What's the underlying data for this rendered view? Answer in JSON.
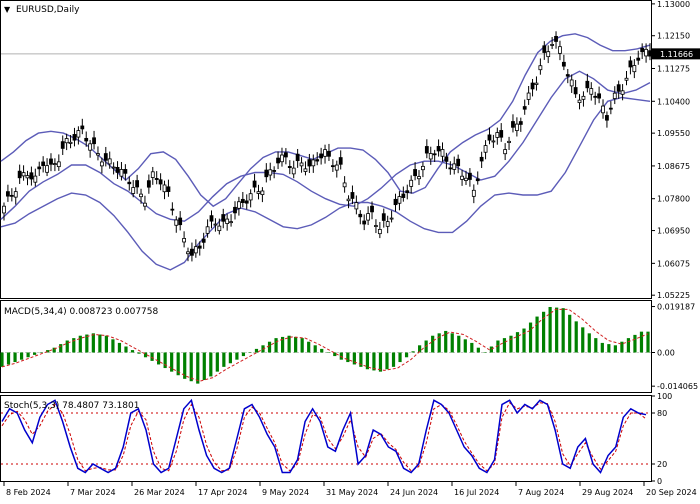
{
  "window": {
    "symbol_title": "EURUSD,Daily",
    "current_price_label": "1.11666"
  },
  "colors": {
    "bollinger": "#5c5cb8",
    "candles": "#000000",
    "macd_histogram": "#008000",
    "macd_signal": "#d02020",
    "stoch_main": "#0000cc",
    "stoch_signal": "#cc0000",
    "levels": "#cc0000",
    "grid": "#c8c8c8",
    "current_price_line": "#b0b0b0"
  },
  "chart_data": [
    {
      "type": "candlestick",
      "name": "price",
      "title": "EURUSD,Daily",
      "y_ticks": [
        "1.13000",
        "1.12150",
        "1.11275",
        "1.10400",
        "1.09550",
        "1.08675",
        "1.07800",
        "1.06950",
        "1.06075",
        "1.05225"
      ],
      "ylim": [
        1.0515,
        1.1305
      ],
      "current_price": 1.11666,
      "x_ticks": [
        "8 Feb 2024",
        "7 Mar 2024",
        "26 Mar 2024",
        "17 Apr 2024",
        "9 May 2024",
        "31 May 2024",
        "24 Jun 2024",
        "16 Jul 2024",
        "7 Aug 2024",
        "29 Aug 2024",
        "20 Sep 2024"
      ],
      "close_path": [
        1.076,
        1.079,
        1.083,
        1.085,
        1.083,
        1.088,
        1.086,
        1.089,
        1.093,
        1.0945,
        1.096,
        1.093,
        1.09,
        1.088,
        1.087,
        1.085,
        1.083,
        1.08,
        1.078,
        1.084,
        1.083,
        1.079,
        1.073,
        1.067,
        1.063,
        1.065,
        1.07,
        1.072,
        1.071,
        1.073,
        1.076,
        1.078,
        1.08,
        1.081,
        1.085,
        1.088,
        1.089,
        1.086,
        1.088,
        1.086,
        1.089,
        1.09,
        1.088,
        1.086,
        1.079,
        1.076,
        1.072,
        1.074,
        1.07,
        1.072,
        1.076,
        1.079,
        1.082,
        1.085,
        1.089,
        1.091,
        1.09,
        1.087,
        1.086,
        1.084,
        1.08,
        1.088,
        1.094,
        1.095,
        1.092,
        1.096,
        1.099,
        1.105,
        1.11,
        1.116,
        1.12,
        1.118,
        1.111,
        1.106,
        1.105,
        1.108,
        1.104,
        1.1,
        1.105,
        1.108,
        1.112,
        1.116,
        1.117
      ],
      "bollinger_upper": [
        1.088,
        1.0905,
        1.0935,
        1.0955,
        1.096,
        1.0955,
        1.094,
        1.092,
        1.089,
        1.086,
        1.083,
        1.086,
        1.09,
        1.0905,
        1.0885,
        1.084,
        1.079,
        1.076,
        1.078,
        1.082,
        1.086,
        1.089,
        1.0905,
        1.0905,
        1.0895,
        1.0885,
        1.09,
        1.0915,
        1.0915,
        1.091,
        1.0885,
        1.085,
        1.08,
        1.0795,
        1.081,
        1.086,
        1.0905,
        1.093,
        1.095,
        1.0965,
        1.099,
        1.104,
        1.111,
        1.117,
        1.12,
        1.1215,
        1.122,
        1.121,
        1.119,
        1.1175,
        1.1175,
        1.118,
        1.119
      ],
      "bollinger_middle": [
        1.0725,
        1.076,
        1.08,
        1.0825,
        1.0845,
        1.087,
        1.087,
        1.085,
        1.082,
        1.08,
        1.077,
        1.074,
        1.0725,
        1.072,
        1.0745,
        1.0785,
        1.082,
        1.084,
        1.085,
        1.085,
        1.0845,
        1.0825,
        1.08,
        1.078,
        1.0765,
        1.076,
        1.078,
        1.081,
        1.0845,
        1.087,
        1.088,
        1.088,
        1.087,
        1.085,
        1.083,
        1.084,
        1.088,
        1.093,
        1.099,
        1.105,
        1.11,
        1.112,
        1.11,
        1.107,
        1.106,
        1.107,
        1.109
      ],
      "bollinger_lower": [
        1.0705,
        1.0715,
        1.074,
        1.076,
        1.078,
        1.0795,
        1.079,
        1.077,
        1.0735,
        1.069,
        1.064,
        1.0605,
        1.059,
        1.061,
        1.066,
        1.07,
        1.074,
        1.0755,
        1.0745,
        1.0725,
        1.0705,
        1.07,
        1.071,
        1.073,
        1.0755,
        1.077,
        1.077,
        1.076,
        1.0745,
        1.072,
        1.07,
        1.069,
        1.069,
        1.072,
        1.076,
        1.079,
        1.0795,
        1.079,
        1.079,
        1.08,
        1.085,
        1.092,
        1.099,
        1.104,
        1.105,
        1.1045,
        1.104
      ]
    },
    {
      "type": "bar",
      "name": "macd",
      "title": "MACD(5,34,4) 0.008723 0.007758",
      "y_ticks": [
        "0.019187",
        "0.00",
        "-0.014065"
      ],
      "ylim": [
        -0.0165,
        0.0215
      ],
      "histogram": [
        -0.006,
        -0.004,
        -0.002,
        0.0,
        0.002,
        0.005,
        0.007,
        0.008,
        0.007,
        0.004,
        0.001,
        -0.002,
        -0.005,
        -0.008,
        -0.011,
        -0.013,
        -0.01,
        -0.006,
        -0.003,
        0.0,
        0.003,
        0.006,
        0.007,
        0.006,
        0.003,
        0.0,
        -0.003,
        -0.005,
        -0.007,
        -0.008,
        -0.006,
        -0.002,
        0.003,
        0.007,
        0.009,
        0.007,
        0.004,
        0.0,
        0.005,
        0.007,
        0.01,
        0.015,
        0.019,
        0.0185,
        0.013,
        0.008,
        0.004,
        0.003,
        0.006,
        0.0087
      ],
      "signal": [
        -0.006,
        -0.0045,
        -0.0025,
        -0.0005,
        0.0015,
        0.004,
        0.006,
        0.0075,
        0.007,
        0.005,
        0.002,
        -0.001,
        -0.004,
        -0.007,
        -0.01,
        -0.012,
        -0.0105,
        -0.007,
        -0.004,
        -0.001,
        0.002,
        0.005,
        0.0065,
        0.006,
        0.0035,
        0.0005,
        -0.0025,
        -0.0045,
        -0.0065,
        -0.0075,
        -0.0065,
        -0.003,
        0.002,
        0.006,
        0.0085,
        0.0075,
        0.0045,
        0.001,
        0.004,
        0.0065,
        0.009,
        0.014,
        0.018,
        0.018,
        0.014,
        0.009,
        0.005,
        0.0035,
        0.0055,
        0.0078
      ]
    },
    {
      "type": "line",
      "name": "stochastic",
      "title": "Stoch(5,3,3) 78.4807 73.1801",
      "y_ticks": [
        "100",
        "80",
        "20",
        "0"
      ],
      "ylim": [
        0,
        100
      ],
      "levels": [
        80,
        20
      ],
      "main": [
        70,
        85,
        80,
        60,
        45,
        75,
        90,
        95,
        70,
        40,
        15,
        10,
        20,
        15,
        10,
        15,
        40,
        80,
        85,
        60,
        20,
        10,
        15,
        50,
        85,
        95,
        60,
        30,
        15,
        10,
        15,
        50,
        85,
        90,
        75,
        55,
        40,
        10,
        10,
        25,
        70,
        85,
        70,
        40,
        35,
        60,
        80,
        20,
        30,
        60,
        55,
        40,
        35,
        15,
        10,
        20,
        60,
        95,
        90,
        80,
        60,
        40,
        30,
        15,
        10,
        25,
        90,
        95,
        80,
        90,
        85,
        95,
        90,
        60,
        20,
        15,
        40,
        50,
        20,
        10,
        30,
        40,
        75,
        85,
        80,
        78
      ],
      "signal": [
        65,
        78,
        82,
        72,
        55,
        65,
        82,
        90,
        80,
        55,
        25,
        12,
        15,
        16,
        13,
        13,
        30,
        65,
        82,
        72,
        35,
        15,
        12,
        35,
        72,
        90,
        75,
        42,
        22,
        12,
        13,
        38,
        75,
        87,
        80,
        62,
        45,
        20,
        12,
        20,
        55,
        78,
        75,
        50,
        38,
        52,
        72,
        40,
        28,
        50,
        56,
        45,
        37,
        22,
        12,
        17,
        45,
        85,
        90,
        83,
        66,
        47,
        33,
        20,
        12,
        20,
        75,
        92,
        85,
        88,
        86,
        92,
        91,
        70,
        32,
        18,
        32,
        45,
        28,
        14,
        24,
        35,
        65,
        80,
        80,
        73
      ]
    }
  ]
}
